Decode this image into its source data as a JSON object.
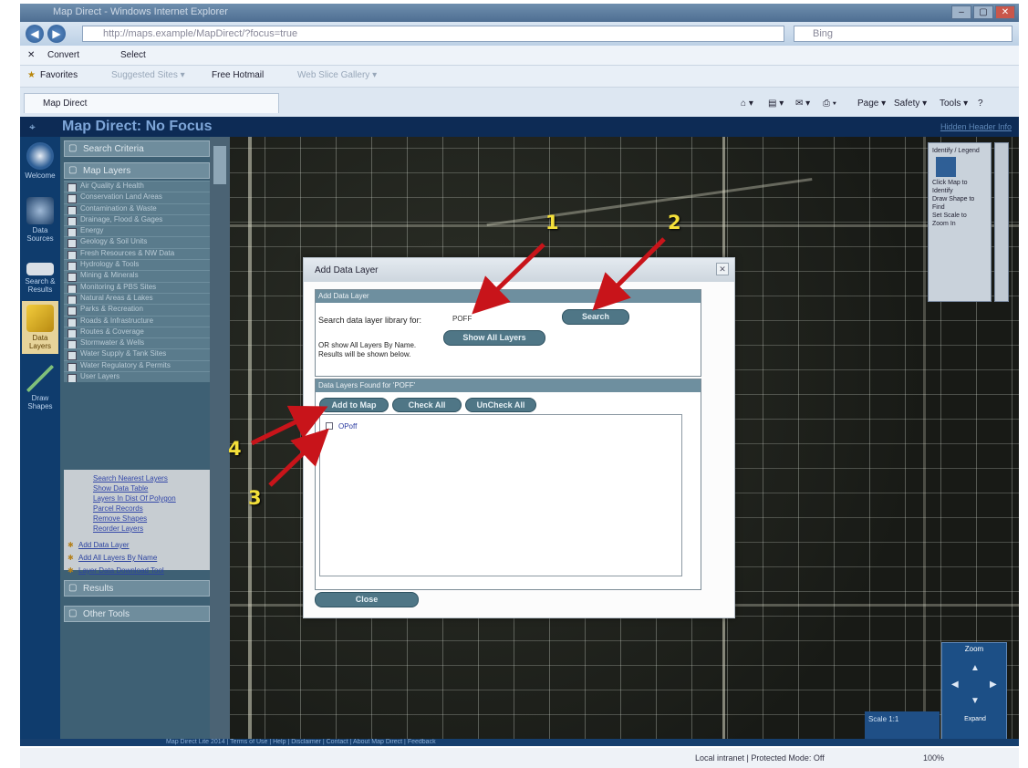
{
  "browser": {
    "window_title": "Map Direct - Windows Internet Explorer",
    "address": "http://maps.example/MapDirect/?focus=true",
    "search_placeholder": "Bing",
    "command_bar": {
      "convert": "Convert",
      "select": "Select"
    },
    "favorites_bar": {
      "favorites": "Favorites",
      "suggested": "Suggested Sites ▾",
      "hotmail": "Free Hotmail",
      "slice": "Web Slice Gallery ▾"
    },
    "tab_label": "Map Direct",
    "toolbar_right": {
      "page": "Page ▾",
      "safety": "Safety ▾",
      "tools": "Tools ▾",
      "help": "?"
    },
    "status": {
      "zone": "Local intranet | Protected Mode: Off",
      "zoom": "100%"
    }
  },
  "app": {
    "title": "Map Direct: No Focus",
    "header_link": "Hidden Header Info",
    "rail": [
      {
        "label": "Welcome",
        "icon": "compass-icon"
      },
      {
        "label": "Data Sources",
        "icon": "map-icon"
      },
      {
        "label": "Search & Results",
        "icon": "search-icon"
      },
      {
        "label": "Data Layers",
        "icon": "layers-icon"
      },
      {
        "label": "Draw Shapes",
        "icon": "pencil-icon"
      }
    ],
    "panel": {
      "section_top": "Search Criteria",
      "section_layers": "Map Layers",
      "layers": [
        "Air Quality & Health",
        "Conservation Land Areas",
        "Contamination & Waste",
        "Drainage, Flood & Gages",
        "Energy",
        "Geology & Soil Units",
        "Fresh Resources & NW Data",
        "Hydrology & Tools",
        "Mining & Minerals",
        "Monitoring & PBS Sites",
        "Natural Areas & Lakes",
        "Parks & Recreation",
        "Roads & Infrastructure",
        "Routes & Coverage",
        "Stormwater & Wells",
        "Water Supply & Tank Sites",
        "Water Regulatory & Permits",
        "User Layers"
      ],
      "sublinks": [
        "Search Nearest Layers",
        "Show Data Table",
        "Layers In Dist Of Polygon",
        "Parcel Records",
        "Remove Shapes",
        "Reorder Layers"
      ],
      "tools": [
        "Add Data Layer",
        "Add All Layers By Name",
        "Layer Data Download Tool"
      ],
      "section_results": "Results",
      "section_other": "Other Tools"
    },
    "legend": {
      "heading": "Identify / Legend",
      "lines": [
        "Click Map to",
        "Identify",
        "Draw Shape to",
        "Find",
        "Set Scale to",
        "Zoom In"
      ]
    },
    "nav": {
      "zoom_label": "Zoom",
      "scale_text": "Scale 1:1",
      "expand": "Expand"
    },
    "status_strip": "Map Direct Lite 2014 | Terms of Use | Help | Disclaimer | Contact | About Map Direct | Feedback"
  },
  "dialog": {
    "title": "Add Data Layer",
    "close_glyph": "✕",
    "search_section": "Add Data Layer",
    "search_label": "Search data layer library for:",
    "search_value": "POFF",
    "search_button": "Search",
    "show_all_button": "Show All Layers",
    "hint": "OR show All Layers By Name. Results will be shown below.",
    "results_section": "Data Layers Found for 'POFF'",
    "add_button": "Add to Map",
    "check_all_button": "Check All",
    "uncheck_all_button": "UnCheck All",
    "result_items": [
      "OPoff"
    ],
    "close_button": "Close"
  },
  "annotations": [
    "1",
    "2",
    "3",
    "4"
  ]
}
